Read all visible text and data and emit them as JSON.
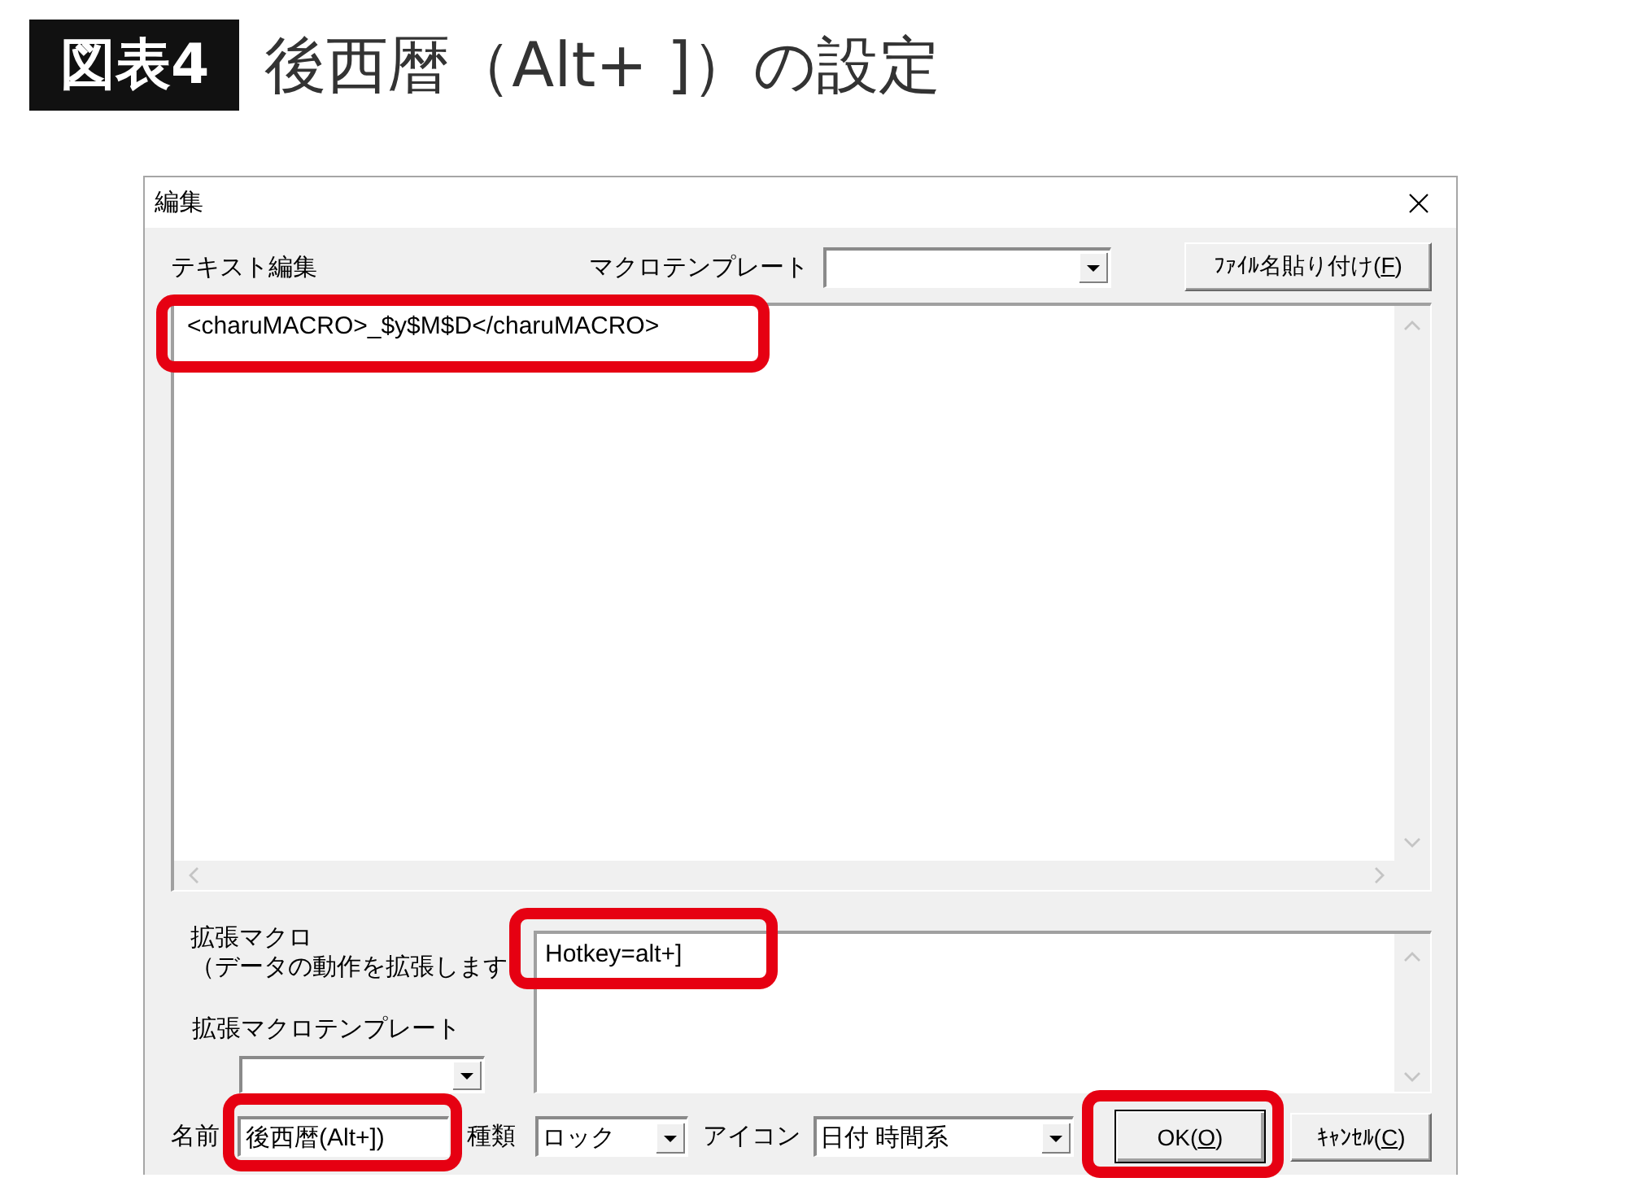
{
  "figure": {
    "number": "図表4",
    "title": "後西暦（Alt+ ]）の設定"
  },
  "dialog": {
    "title": "編集",
    "text_edit": {
      "label": "テキスト編集",
      "lines": [
        {
          "text": "<charuMACRO>_$y$M$D</charuMACRO>",
          "highlighted": true
        }
      ]
    },
    "macro_template": {
      "label": "マクロテンプレート"
    },
    "paste_file_name_button": {
      "label": "ﾌｧｲﾙ名貼り付け(F)",
      "access_key_underlined": true
    },
    "extended_macro": {
      "label_lines": [
        "拡張マクロ",
        "（データの動作を拡張します"
      ],
      "lines": [
        {
          "text": "Hotkey=alt+]",
          "highlighted": true
        }
      ]
    },
    "extended_macro_template": {
      "label": "拡張マクロテンプレート"
    },
    "name": {
      "label": "名前",
      "value": "後西暦(Alt+])",
      "highlighted": true
    },
    "type": {
      "label": "種類",
      "value": "ロック"
    },
    "icon": {
      "label": "アイコン",
      "value": "日付 時間系"
    },
    "buttons": [
      {
        "label": "OK(O)",
        "default": true,
        "access_key_underlined": true,
        "highlighted": true
      },
      {
        "label": "ｷｬﾝｾﾙ(C)",
        "default": false,
        "access_key_underlined": true,
        "highlighted": false
      }
    ]
  }
}
